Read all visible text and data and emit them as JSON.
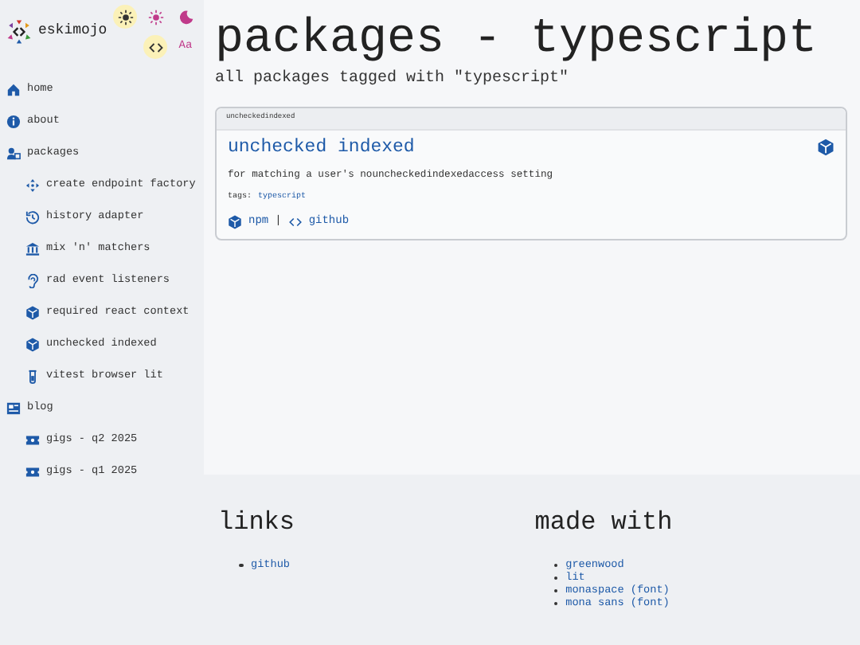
{
  "site": {
    "name": "eskimojo"
  },
  "theme_buttons": [
    {
      "kind": "auto",
      "selected": true
    },
    {
      "kind": "light",
      "selected": false
    },
    {
      "kind": "dark",
      "selected": false
    }
  ],
  "font_buttons": [
    {
      "kind": "code",
      "selected": true
    },
    {
      "kind": "text",
      "label": "Aa",
      "selected": false
    }
  ],
  "sidebar": {
    "items": [
      {
        "label": "home",
        "kind": "home"
      },
      {
        "label": "about",
        "kind": "info"
      },
      {
        "label": "packages",
        "kind": "people",
        "children": [
          {
            "label": "create endpoint factory",
            "kind": "arrows"
          },
          {
            "label": "history adapter",
            "kind": "history"
          },
          {
            "label": "mix 'n' matchers",
            "kind": "bank"
          },
          {
            "label": "rad event listeners",
            "kind": "ear"
          },
          {
            "label": "required react context",
            "kind": "cube"
          },
          {
            "label": "unchecked indexed",
            "kind": "cube"
          },
          {
            "label": "vitest browser lit",
            "kind": "tube"
          }
        ]
      },
      {
        "label": "blog",
        "kind": "news",
        "children": [
          {
            "label": "gigs - q2 2025",
            "kind": "ticket"
          },
          {
            "label": "gigs - q1 2025",
            "kind": "ticket"
          }
        ]
      }
    ]
  },
  "page": {
    "title": "packages - typescript",
    "subtitle": "all packages tagged with \"typescript\""
  },
  "cards": [
    {
      "header": "uncheckedindexed",
      "title": "unchecked indexed",
      "description": "for matching a user's nouncheckedindexedaccess setting",
      "tags_label": "tags:",
      "tags": [
        "typescript"
      ],
      "links": [
        "npm",
        "github"
      ],
      "separator": "|"
    }
  ],
  "footer": {
    "sections": [
      {
        "title": "links",
        "items": [
          "github"
        ]
      },
      {
        "title": "made with",
        "items": [
          "greenwood",
          "lit",
          "monaspace (font)",
          "mona sans (font)"
        ]
      }
    ]
  }
}
